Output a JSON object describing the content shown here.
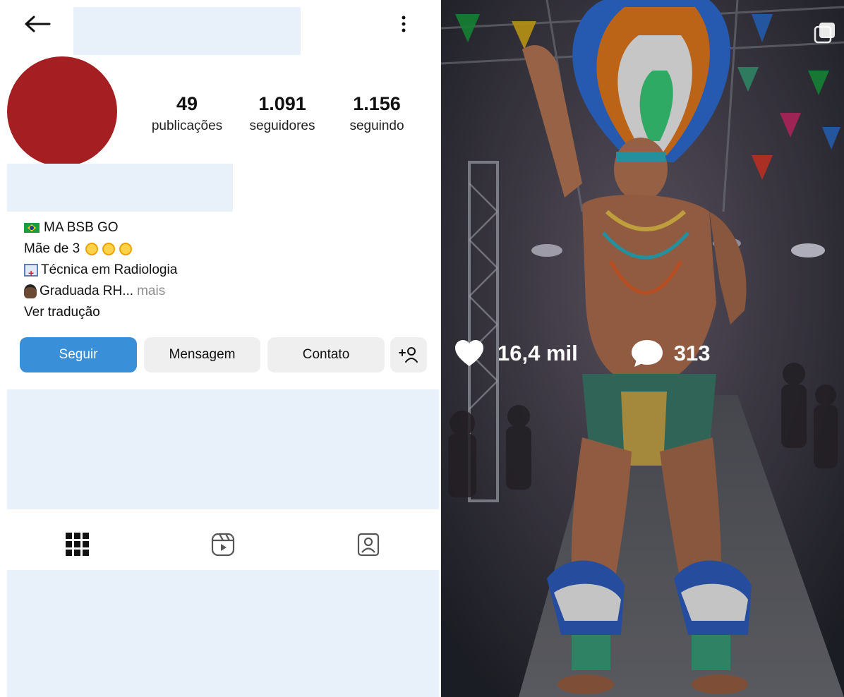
{
  "profile": {
    "stats": [
      {
        "value": "49",
        "label": "publicações"
      },
      {
        "value": "1.091",
        "label": "seguidores"
      },
      {
        "value": "1.156",
        "label": "seguindo"
      }
    ],
    "bio": {
      "line1": "MA BSB GO",
      "line2": "Mãe de 3",
      "line3": "Técnica em Radiologia",
      "line4": "Graduada RH...",
      "more": " mais",
      "translate": "Ver tradução"
    },
    "buttons": {
      "follow": "Seguir",
      "message": "Mensagem",
      "contact": "Contato"
    },
    "colors": {
      "follow_button": "#3a8fd9",
      "avatar": "#a41e22",
      "redaction": "#e8f0fa"
    }
  },
  "post": {
    "likes": "16,4 mil",
    "comments": "313"
  },
  "icons": {
    "back": "back-arrow-icon",
    "menu": "kebab-menu-icon",
    "add_person": "add-person-icon",
    "grid": "grid-icon",
    "reels": "reels-icon",
    "tagged": "tagged-icon",
    "heart": "heart-icon",
    "comment": "comment-bubble-icon",
    "multi": "multiple-photos-icon"
  }
}
